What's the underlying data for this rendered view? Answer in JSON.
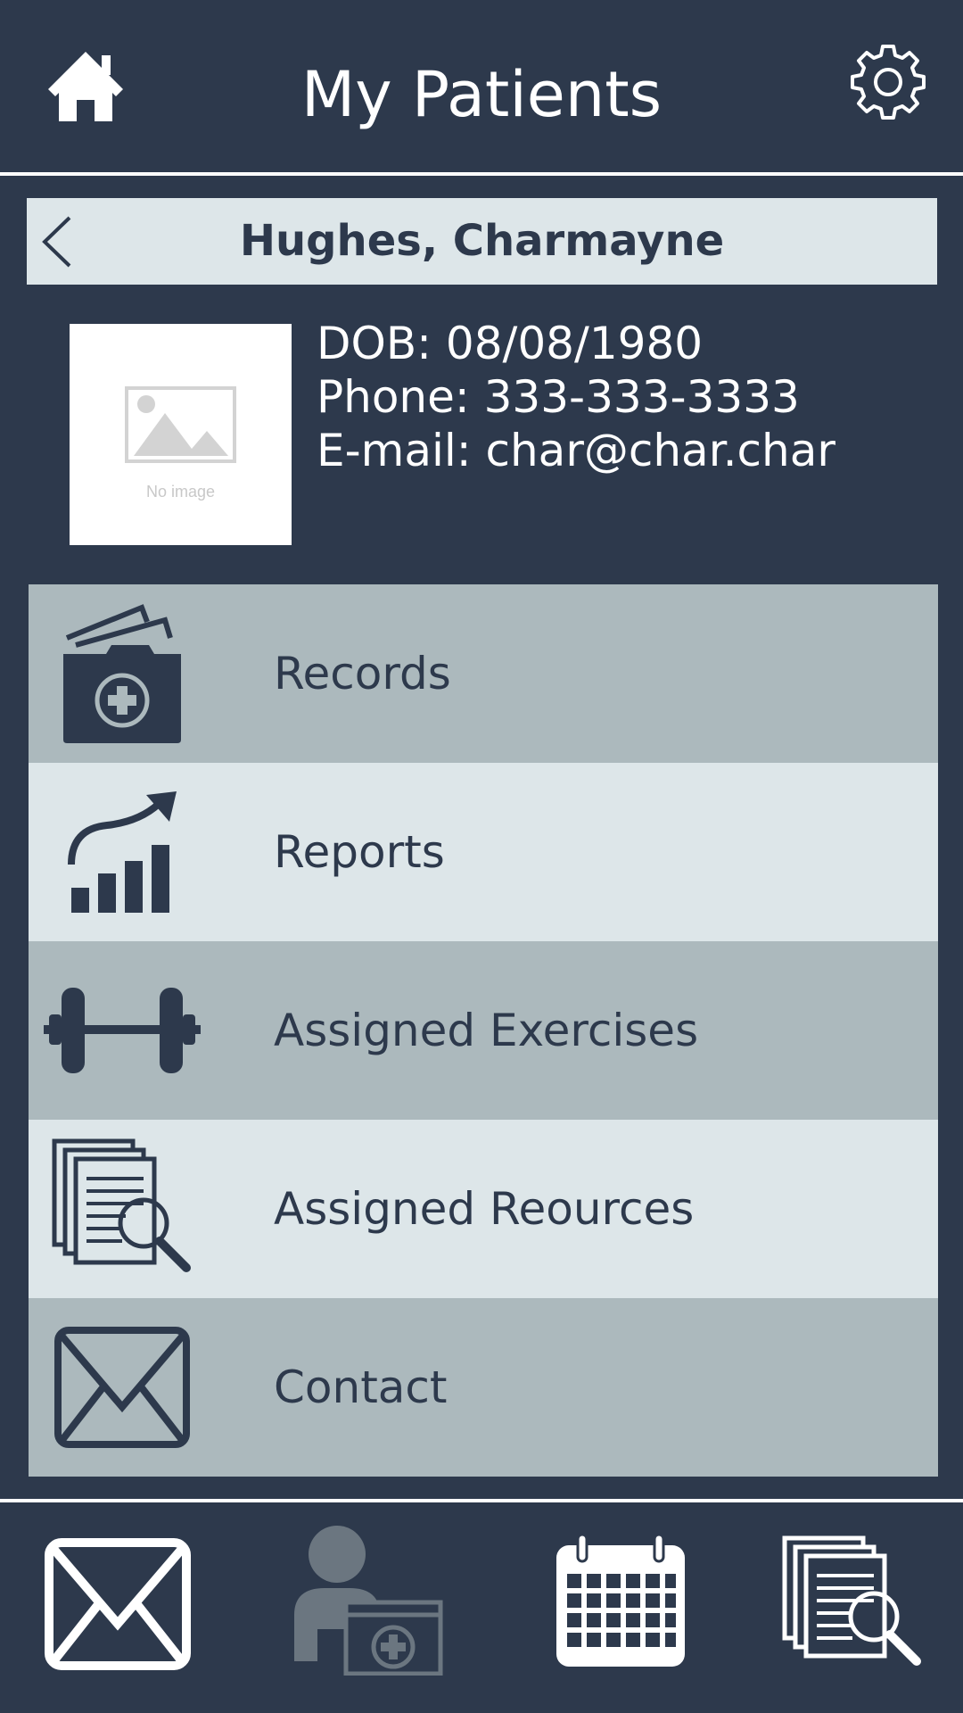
{
  "header": {
    "title": "My Patients",
    "home_icon": "home-icon",
    "settings_icon": "gear-icon"
  },
  "patient": {
    "name": "Hughes, Charmayne",
    "photo_placeholder": "No image",
    "dob_line": "DOB: 08/08/1980",
    "phone_line": "Phone: 333-333-3333",
    "email_line": "E-mail: char@char.char"
  },
  "menu": {
    "items": [
      {
        "label": "Records",
        "icon": "medical-folder-icon"
      },
      {
        "label": "Reports",
        "icon": "bar-chart-icon"
      },
      {
        "label": "Assigned Exercises",
        "icon": "dumbbell-icon"
      },
      {
        "label": "Assigned Reources",
        "icon": "document-search-icon"
      },
      {
        "label": "Contact",
        "icon": "envelope-icon"
      }
    ]
  },
  "footer": {
    "items": [
      {
        "icon": "envelope-icon",
        "active": true
      },
      {
        "icon": "patient-record-icon",
        "active": false
      },
      {
        "icon": "calendar-icon",
        "active": true
      },
      {
        "icon": "document-search-icon",
        "active": true
      }
    ]
  },
  "colors": {
    "background": "#2d394c",
    "row_dark": "#acb9bd",
    "row_light": "#dde6e9",
    "text_light": "#ffffff",
    "disabled_icon": "#6b7680"
  }
}
